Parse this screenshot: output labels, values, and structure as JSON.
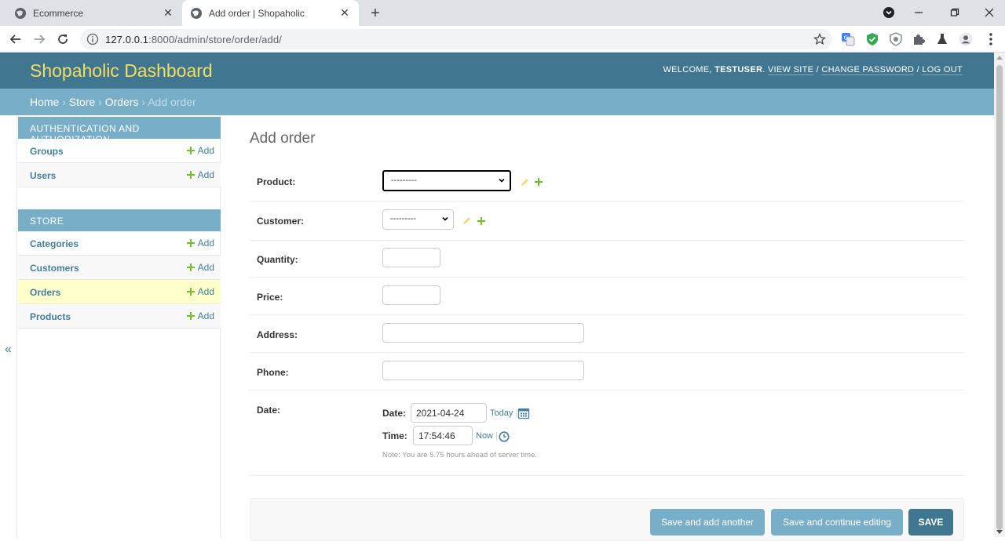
{
  "browser": {
    "tabs": [
      {
        "title": "Ecommerce"
      },
      {
        "title": "Add order | Shopaholic"
      }
    ],
    "url_host": "127.0.0.1",
    "url_rest": ":8000/admin/store/order/add/"
  },
  "header": {
    "brand": "Shopaholic Dashboard",
    "welcome": "Welcome,",
    "username": "testuser",
    "view_site": "View site",
    "change_password": "Change password",
    "log_out": "Log out",
    "sep": "/"
  },
  "breadcrumbs": {
    "home": "Home",
    "store": "Store",
    "orders": "Orders",
    "current": "Add order",
    "sep": "›"
  },
  "sidebar": {
    "modules": [
      {
        "caption": "Authentication and Authorization",
        "models": [
          {
            "name": "Groups",
            "add": "Add"
          },
          {
            "name": "Users",
            "add": "Add"
          }
        ]
      },
      {
        "caption": "Store",
        "models": [
          {
            "name": "Categories",
            "add": "Add"
          },
          {
            "name": "Customers",
            "add": "Add"
          },
          {
            "name": "Orders",
            "add": "Add"
          },
          {
            "name": "Products",
            "add": "Add"
          }
        ]
      }
    ],
    "collapse_label": "«"
  },
  "form": {
    "title": "Add order",
    "product_label": "Product:",
    "product_value": "---------",
    "customer_label": "Customer:",
    "customer_value": "---------",
    "quantity_label": "Quantity:",
    "quantity_value": "",
    "price_label": "Price:",
    "price_value": "",
    "address_label": "Address:",
    "address_value": "",
    "phone_label": "Phone:",
    "phone_value": "",
    "date_label": "Date:",
    "date_sub_label": "Date:",
    "date_value": "2021-04-24",
    "today_link": "Today",
    "time_sub_label": "Time:",
    "time_value": "17:54:46",
    "now_link": "Now",
    "shortcut_sep": "|",
    "help_text": "Note: You are 5.75 hours ahead of server time."
  },
  "buttons": {
    "save_add_another": "Save and add another",
    "save_continue": "Save and continue editing",
    "save": "SAVE"
  },
  "colors": {
    "header_bg": "#417690",
    "brand_text": "#f5dd5d",
    "breadcrumb_bg": "#79aec8",
    "link": "#447e9b",
    "add_plus": "#70bf2b",
    "current_row": "#ffffcc"
  }
}
